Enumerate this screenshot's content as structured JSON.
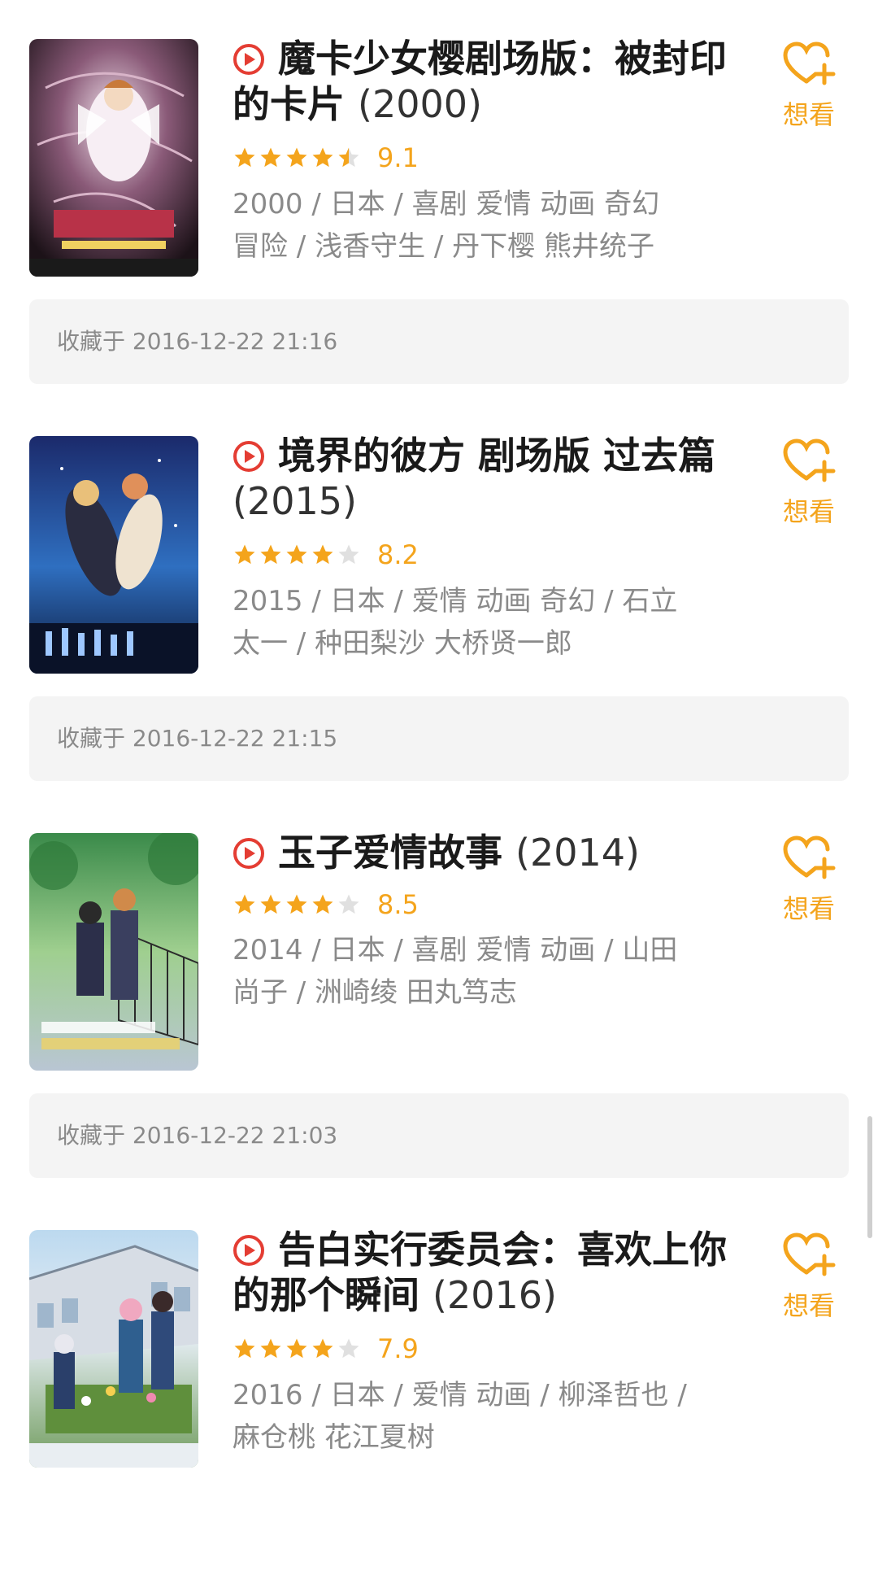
{
  "items": [
    {
      "title": "魔卡少女樱剧场版：被封印的卡片",
      "year": "(2000)",
      "rating": 4.5,
      "score": "9.1",
      "meta_line1": "2000 / 日本 / 喜剧 爱情 动画 奇幻",
      "meta_line2": "冒险 / 浅香守生 / 丹下樱 熊井统子",
      "want_label": "想看",
      "collected": "收藏于 2016-12-22 21:16"
    },
    {
      "title": "境界的彼方 剧场版 过去篇",
      "year": "(2015)",
      "rating": 4,
      "score": "8.2",
      "meta_line1": "2015 / 日本 / 爱情 动画 奇幻 / 石立",
      "meta_line2": "太一 / 种田梨沙 大桥贤一郎",
      "want_label": "想看",
      "collected": "收藏于 2016-12-22 21:15"
    },
    {
      "title": "玉子爱情故事",
      "year": "(2014)",
      "rating": 4,
      "score": "8.5",
      "meta_line1": "2014 / 日本 / 喜剧 爱情 动画 / 山田",
      "meta_line2": "尚子 / 洲崎绫 田丸笃志",
      "want_label": "想看",
      "collected": "收藏于 2016-12-22 21:03"
    },
    {
      "title": "告白实行委员会：喜欢上你的那个瞬间",
      "year": "(2016)",
      "rating": 4,
      "score": "7.9",
      "meta_line1": "2016 / 日本 / 爱情 动画 / 柳泽哲也 /",
      "meta_line2": "麻仓桃 花江夏树",
      "want_label": "想看",
      "collected": ""
    }
  ],
  "colors": {
    "accent": "#f4a41c",
    "play": "#e43d33",
    "star_empty": "#e0e0e0"
  }
}
